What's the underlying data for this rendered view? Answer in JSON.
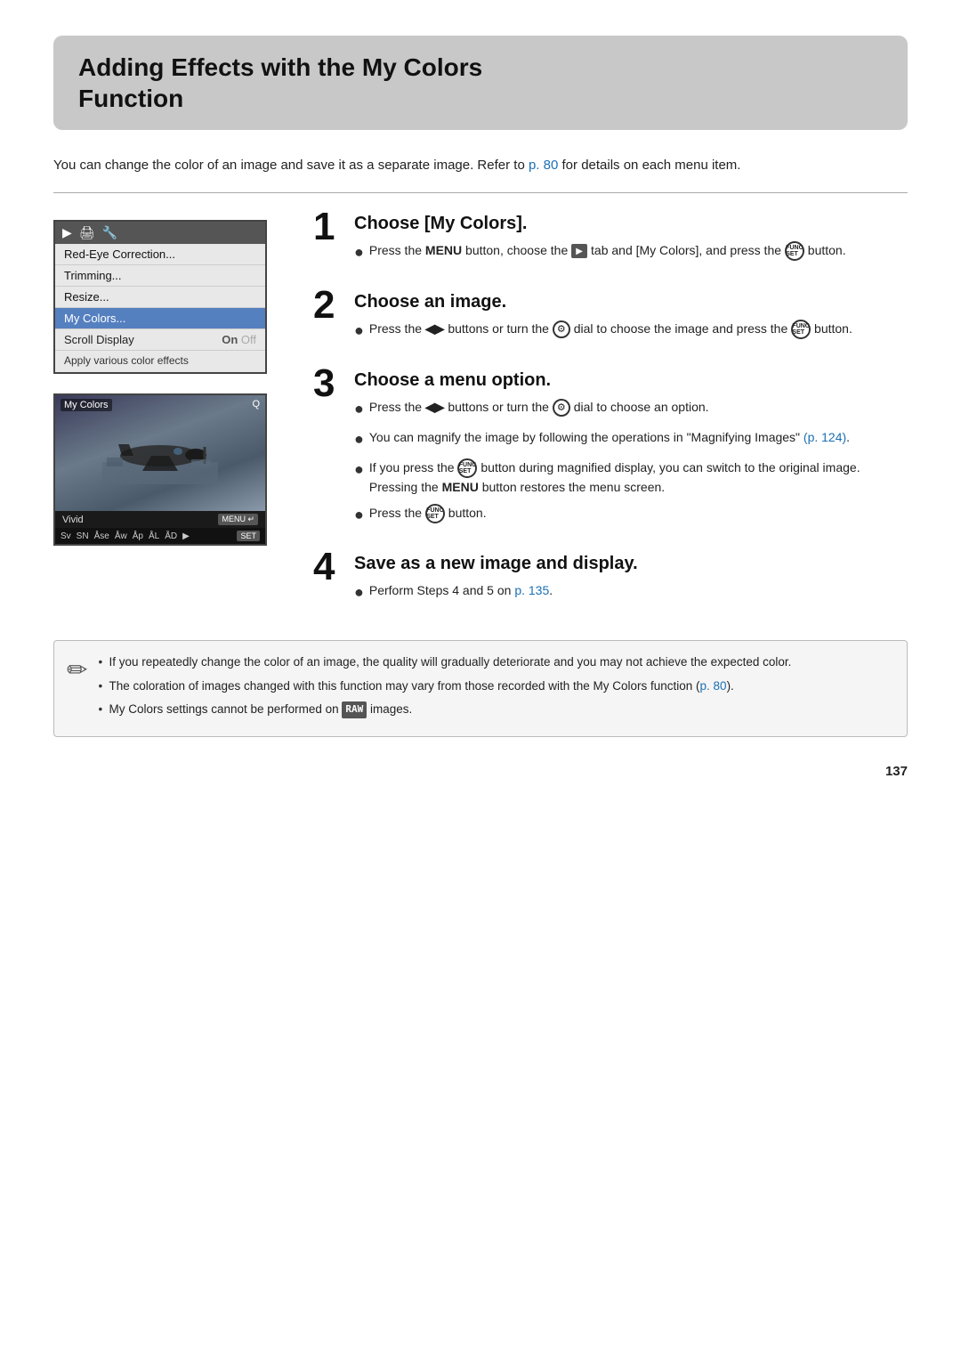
{
  "page": {
    "title_line1": "Adding Effects with the My Colors",
    "title_line2": "Function",
    "intro": {
      "text": "You can change the color of an image and save it as a separate image. Refer to",
      "link_text": "p. 80",
      "text2": "for details on each menu item."
    },
    "steps": [
      {
        "number": "1",
        "heading": "Choose [My Colors].",
        "bullets": [
          {
            "text_parts": [
              "Press the ",
              "MENU",
              " button, choose the ",
              "▶",
              " tab and [My Colors], and press the ",
              "FUNC/SET",
              " button."
            ]
          }
        ]
      },
      {
        "number": "2",
        "heading": "Choose an image.",
        "bullets": [
          {
            "text_parts": [
              "Press the ",
              "◀▶",
              " buttons or turn the ",
              "⚙",
              " dial to choose the image and press the ",
              "FUNC/SET",
              " button."
            ]
          }
        ]
      },
      {
        "number": "3",
        "heading": "Choose a menu option.",
        "bullets": [
          {
            "text_parts": [
              "Press the ",
              "◀▶",
              " buttons or turn the ",
              "⚙",
              " dial to choose an option."
            ]
          },
          {
            "text_parts": [
              "You can magnify the image by following the operations in \"Magnifying Images\" ",
              "p. 124",
              "."
            ]
          },
          {
            "text_parts": [
              "If you press the ",
              "FUNC/SET",
              " button during magnified display, you can switch to the original image. Pressing the ",
              "MENU",
              " button restores the menu screen."
            ]
          },
          {
            "text_parts": [
              "Press the ",
              "FUNC/SET",
              " button."
            ]
          }
        ]
      },
      {
        "number": "4",
        "heading": "Save as a new image and display.",
        "bullets": [
          {
            "text_parts": [
              "Perform Steps 4 and 5 on ",
              "p. 135",
              "."
            ]
          }
        ]
      }
    ],
    "notes": [
      "If you repeatedly change the color of an image, the quality will gradually deteriorate and you may not achieve the expected color.",
      "The coloration of images changed with this function may vary from those recorded with the My Colors function (p. 80).",
      "My Colors settings cannot be performed on RAW images."
    ],
    "notes_link_1": "p. 80",
    "page_number": "137",
    "menu_mockup": {
      "tabs": [
        "▶",
        "🖨",
        "🔧"
      ],
      "items": [
        {
          "label": "Red-Eye Correction...",
          "active": false
        },
        {
          "label": "Trimming...",
          "active": false
        },
        {
          "label": "Resize...",
          "active": false
        },
        {
          "label": "My Colors...",
          "active": true
        },
        {
          "label": "Scroll Display",
          "toggle_on": "On",
          "toggle_off": "Off"
        },
        {
          "label": "Apply various color effects",
          "caption": true
        }
      ]
    },
    "camera_screen": {
      "label": "My Colors",
      "mode": "Vivid",
      "icons": [
        "Sv",
        "SN",
        "Ase",
        "Aw",
        "Ap",
        "AL",
        "AD",
        "▶",
        "SET"
      ]
    }
  }
}
